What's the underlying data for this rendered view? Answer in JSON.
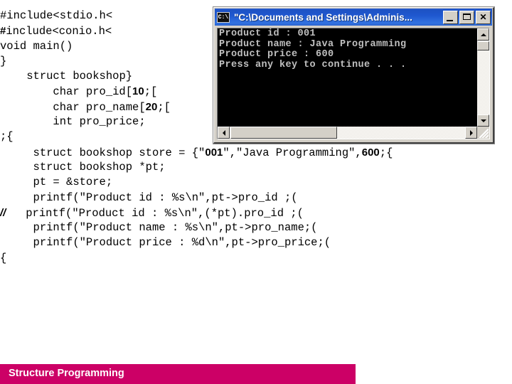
{
  "slide": {
    "code_lines": [
      {
        "indent": 0,
        "segments": [
          {
            "text": "#include<stdio.h<",
            "style": "normal"
          }
        ]
      },
      {
        "indent": 0,
        "segments": [
          {
            "text": "#",
            "style": "bold-sans"
          },
          {
            "text": "include<conio.h<",
            "style": "normal"
          }
        ]
      },
      {
        "indent": 0,
        "segments": [
          {
            "text": "void main()",
            "style": "normal"
          }
        ]
      },
      {
        "indent": 0,
        "segments": [
          {
            "text": "}",
            "style": "normal"
          }
        ]
      },
      {
        "indent": 4,
        "segments": [
          {
            "text": "struct bookshop}",
            "style": "normal"
          }
        ]
      },
      {
        "indent": 8,
        "segments": [
          {
            "text": "char pro_id[",
            "style": "normal"
          },
          {
            "text": "10",
            "style": "bold-sans"
          },
          {
            "text": ";[",
            "style": "normal"
          }
        ]
      },
      {
        "indent": 8,
        "segments": [
          {
            "text": "char pro_name[",
            "style": "normal"
          },
          {
            "text": "20",
            "style": "bold-sans"
          },
          {
            "text": ";[",
            "style": "normal"
          }
        ]
      },
      {
        "indent": 8,
        "segments": [
          {
            "text": "int pro_price;",
            "style": "normal"
          }
        ]
      },
      {
        "indent": 0,
        "segments": [
          {
            "text": ";{",
            "style": "normal"
          }
        ]
      },
      {
        "indent": 5,
        "segments": [
          {
            "text": "struct bookshop store = {\"",
            "style": "normal"
          },
          {
            "text": "001",
            "style": "bold-sans"
          },
          {
            "text": "\",\"Java Programming\",",
            "style": "normal"
          },
          {
            "text": "600",
            "style": "bold-sans"
          },
          {
            "text": ";{",
            "style": "normal"
          }
        ]
      },
      {
        "indent": 5,
        "segments": [
          {
            "text": "struct bookshop *pt;",
            "style": "normal"
          }
        ]
      },
      {
        "indent": 5,
        "segments": [
          {
            "text": "pt = &store;",
            "style": "normal"
          }
        ]
      },
      {
        "indent": 5,
        "segments": [
          {
            "text": "printf(\"Product id : %s\\n\",pt->pro_id ;(",
            "style": "normal"
          }
        ]
      },
      {
        "indent": 0,
        "segments": [
          {
            "text": "//",
            "style": "bold-italic-sans"
          },
          {
            "text": "   printf(\"Product id : %s\\n\",(*pt).pro_id ;(",
            "style": "normal"
          }
        ]
      },
      {
        "indent": 5,
        "segments": [
          {
            "text": "printf(\"Product name : %s\\n\",pt->pro_name;(",
            "style": "normal"
          }
        ]
      },
      {
        "indent": 5,
        "segments": [
          {
            "text": "printf(\"Product price : %d\\n\",pt->pro_price;(",
            "style": "normal"
          }
        ]
      },
      {
        "indent": 0,
        "segments": [
          {
            "text": "{",
            "style": "normal"
          }
        ]
      }
    ]
  },
  "console_window": {
    "title": "\"C:\\Documents and Settings\\Adminis...",
    "icon_name": "console-icon",
    "icon_glyph": "C:\\",
    "buttons": {
      "minimize": "minimize-button",
      "maximize": "maximize-button",
      "close_label": "✕"
    },
    "output_lines": [
      "Product id : 001",
      "Product name : Java Programming",
      "Product price : 600",
      "Press any key to continue . . ."
    ],
    "scrollbars": {
      "vertical": "vertical-scrollbar",
      "horizontal": "horizontal-scrollbar"
    }
  },
  "footer": {
    "label": "Structure Programming",
    "color": "#cc0066"
  }
}
